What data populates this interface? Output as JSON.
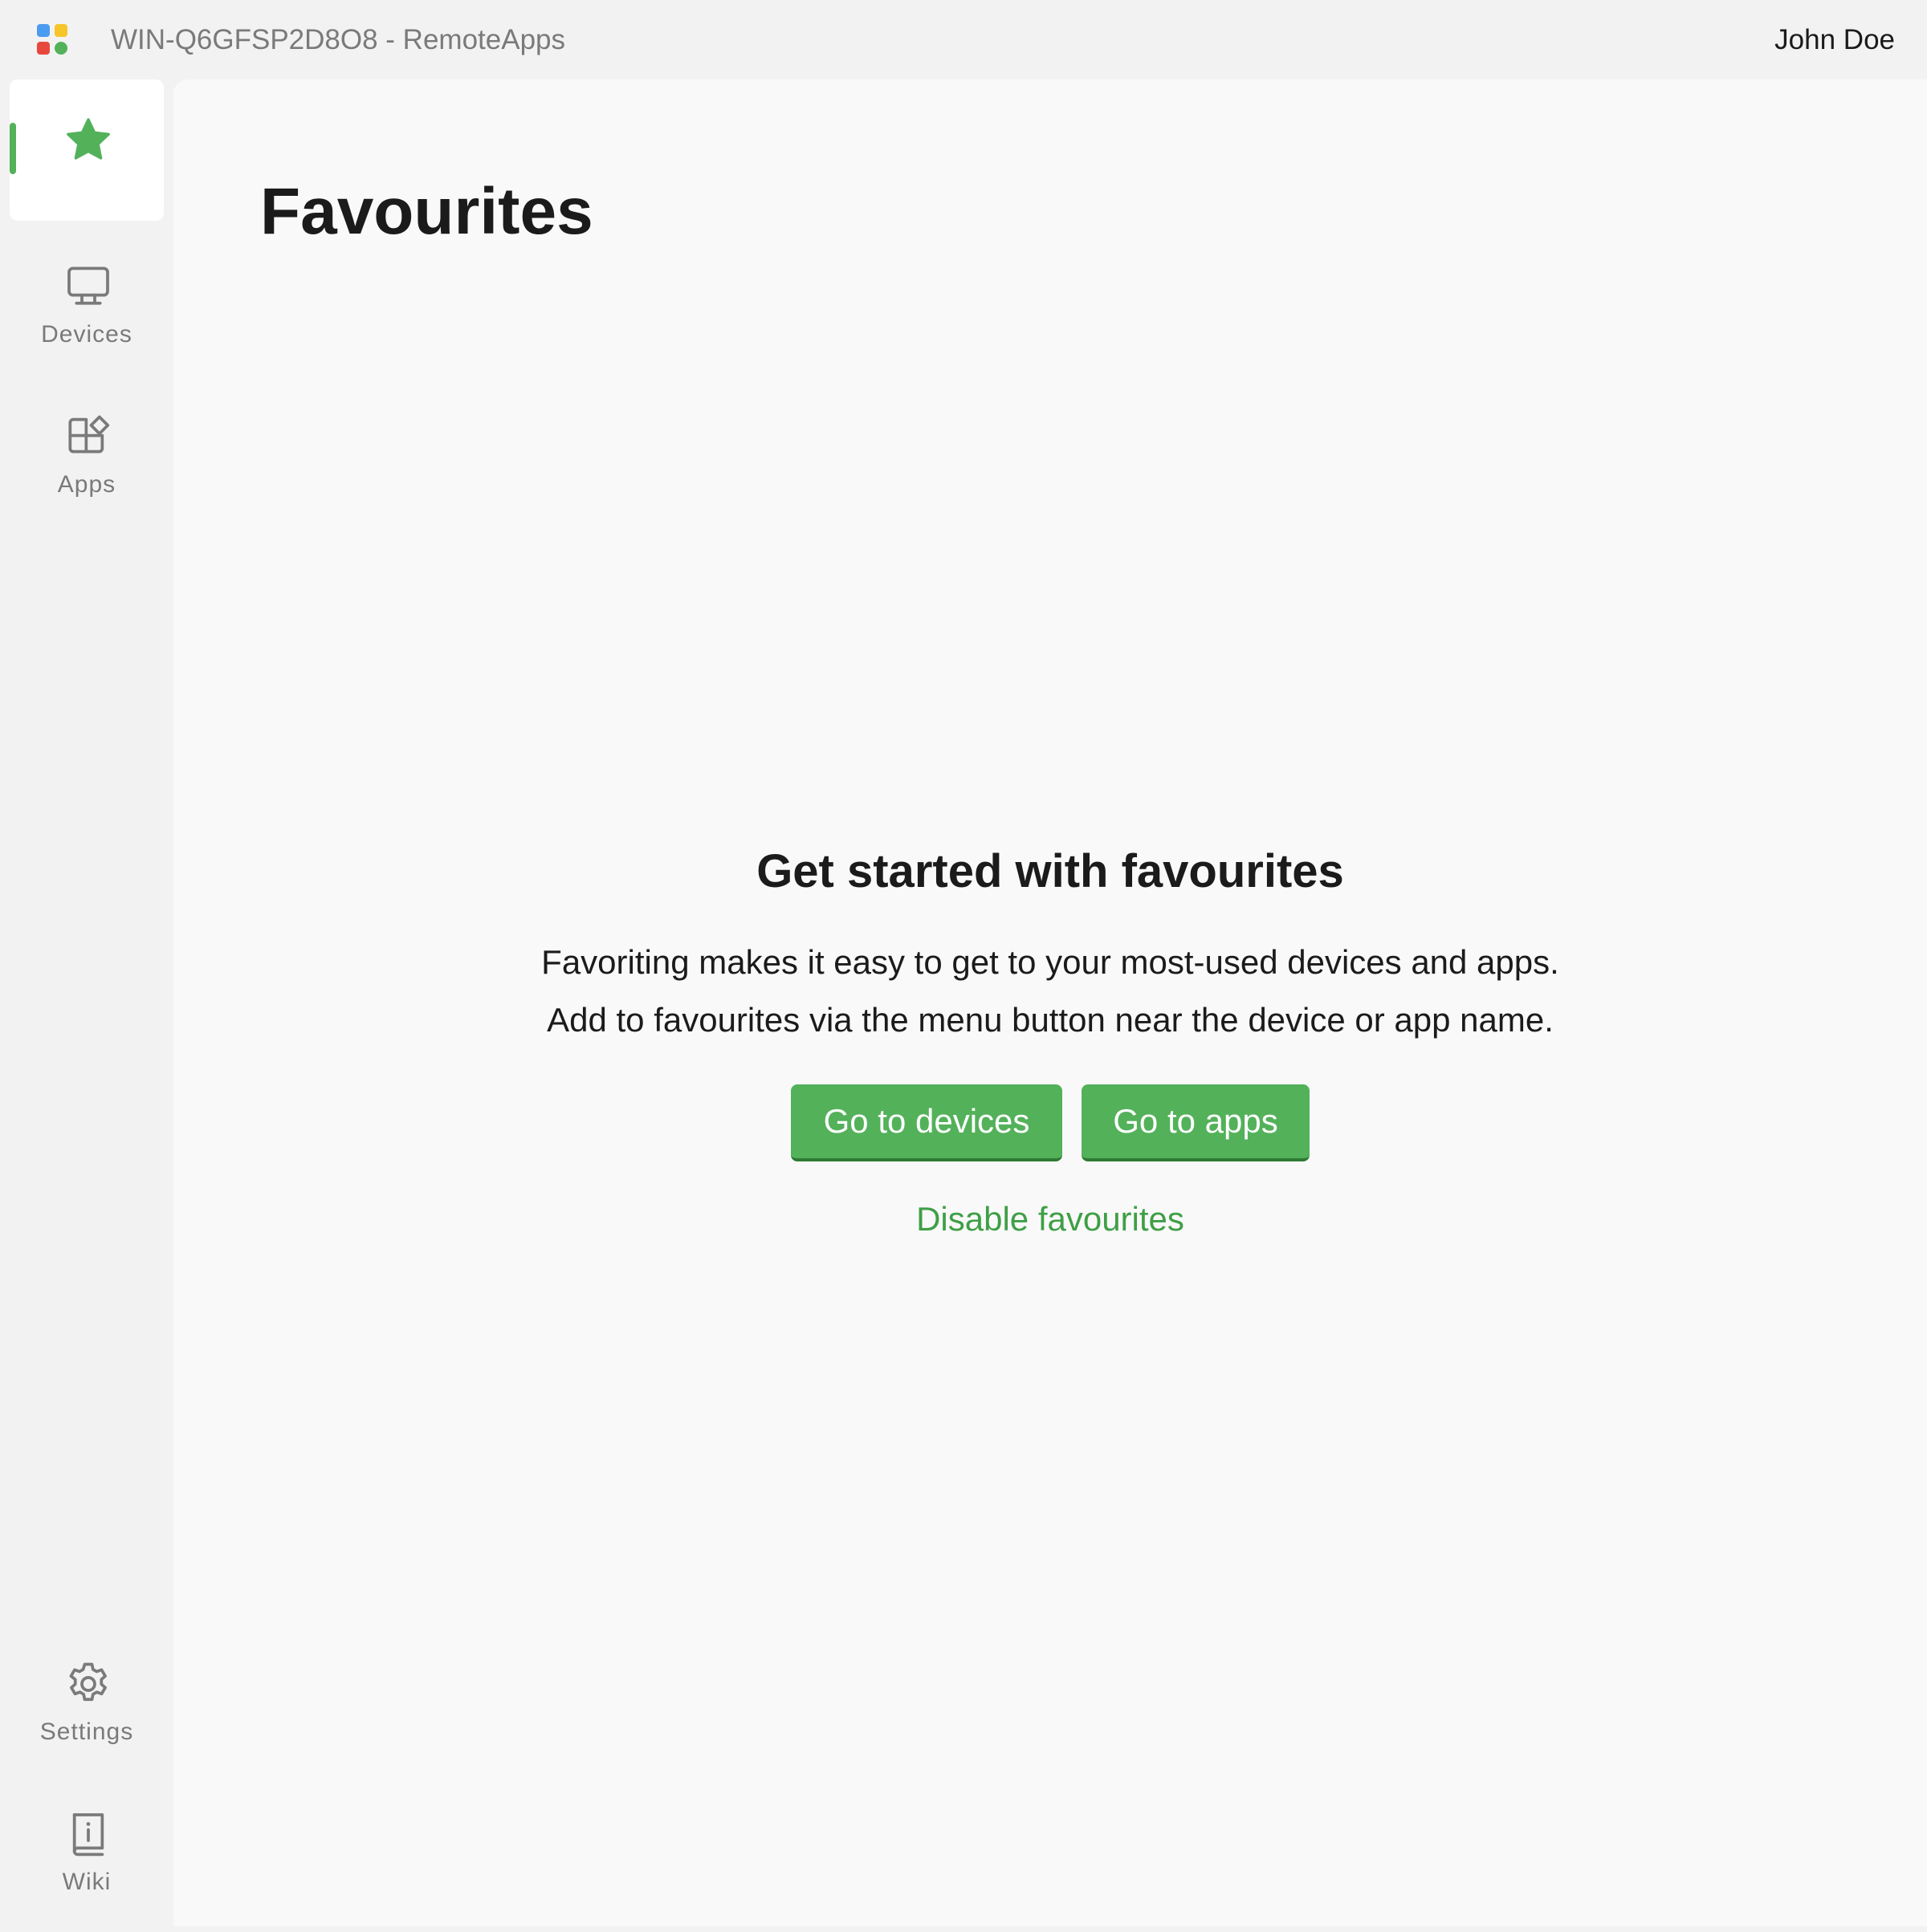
{
  "window": {
    "title": "WIN-Q6GFSP2D8O8 - RemoteApps",
    "user_name": "John Doe"
  },
  "colors": {
    "accent": "#53b15a",
    "accent_dark": "#2e7a33",
    "link": "#3f9f46",
    "icon_gray": "#7a7a7a",
    "logo_blue": "#4a9cf0",
    "logo_yellow": "#f5c52a",
    "logo_red": "#e8473e",
    "logo_green": "#53b15a"
  },
  "sidebar": {
    "items": [
      {
        "id": "favourites",
        "label": "",
        "icon": "star-icon",
        "active": true
      },
      {
        "id": "devices",
        "label": "Devices",
        "icon": "monitor-icon",
        "active": false
      },
      {
        "id": "apps",
        "label": "Apps",
        "icon": "apps-icon",
        "active": false
      }
    ],
    "bottom_items": [
      {
        "id": "settings",
        "label": "Settings",
        "icon": "gear-icon"
      },
      {
        "id": "wiki",
        "label": "Wiki",
        "icon": "book-icon"
      }
    ]
  },
  "main": {
    "page_title": "Favourites",
    "empty_state": {
      "heading": "Get started with favourites",
      "description_lines": [
        "Favoriting makes it easy to get to your most-used devices and apps.",
        "Add to favourites via the menu button near the device or app name."
      ],
      "buttons": [
        {
          "label": "Go to devices"
        },
        {
          "label": "Go to apps"
        }
      ],
      "link": "Disable favourites"
    }
  }
}
